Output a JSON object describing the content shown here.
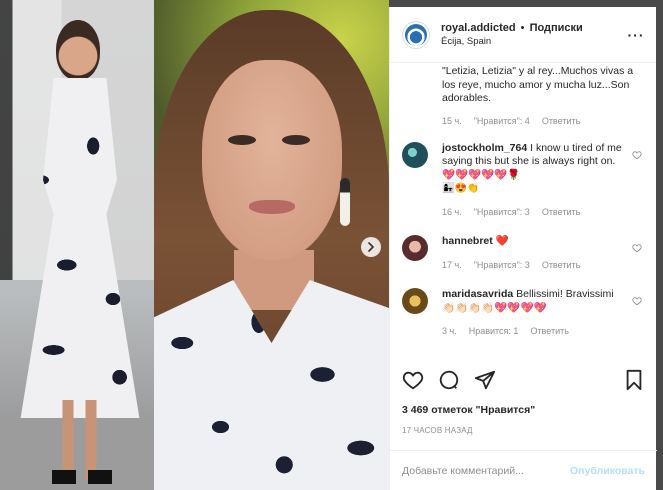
{
  "post": {
    "username": "royal.addicted",
    "separator": "•",
    "follow_label": "Подписки",
    "location": "Écija, Spain",
    "more_label": "···"
  },
  "comments": {
    "first": {
      "text": "\"Letizia, Letizia\" y al rey...Muchos vivas a los reye, mucho amor y mucha luz...Son adorables.",
      "time": "15 ч.",
      "likes": "\"Нравится\": 4",
      "reply": "Ответить"
    },
    "items": [
      {
        "user": "jostockholm_764",
        "text": "I know u tired of me saying this but she is always right on.💖💖💖💖💖🌹",
        "emoji": "👩‍👧😍👏",
        "time": "16 ч.",
        "likes": "\"Нравится\": 3",
        "reply": "Ответить",
        "avatar_color": "#1f4f5a"
      },
      {
        "user": "hannebret",
        "text": "❤️",
        "time": "17 ч.",
        "likes": "\"Нравится\": 3",
        "reply": "Ответить",
        "avatar_color": "#c24a5c"
      },
      {
        "user": "maridasavrida",
        "text": "Bellissimi! Bravissimi👏🏻👏🏻👏🏻👏🏻💖💖💖💖",
        "time": "3 ч.",
        "likes": "Нравится: 1",
        "reply": "Ответить",
        "avatar_color": "#b88a2a"
      }
    ]
  },
  "actions": {
    "likes_count": "3 469 отметок \"Нравится\"",
    "timestamp": "17 часов назад"
  },
  "add_comment": {
    "placeholder": "Добавьте комментарий...",
    "publish_label": "Опубликовать"
  },
  "colors": {
    "publish_disabled": "#b2dffc",
    "muted": "#8e8e8e",
    "text": "#262626"
  }
}
